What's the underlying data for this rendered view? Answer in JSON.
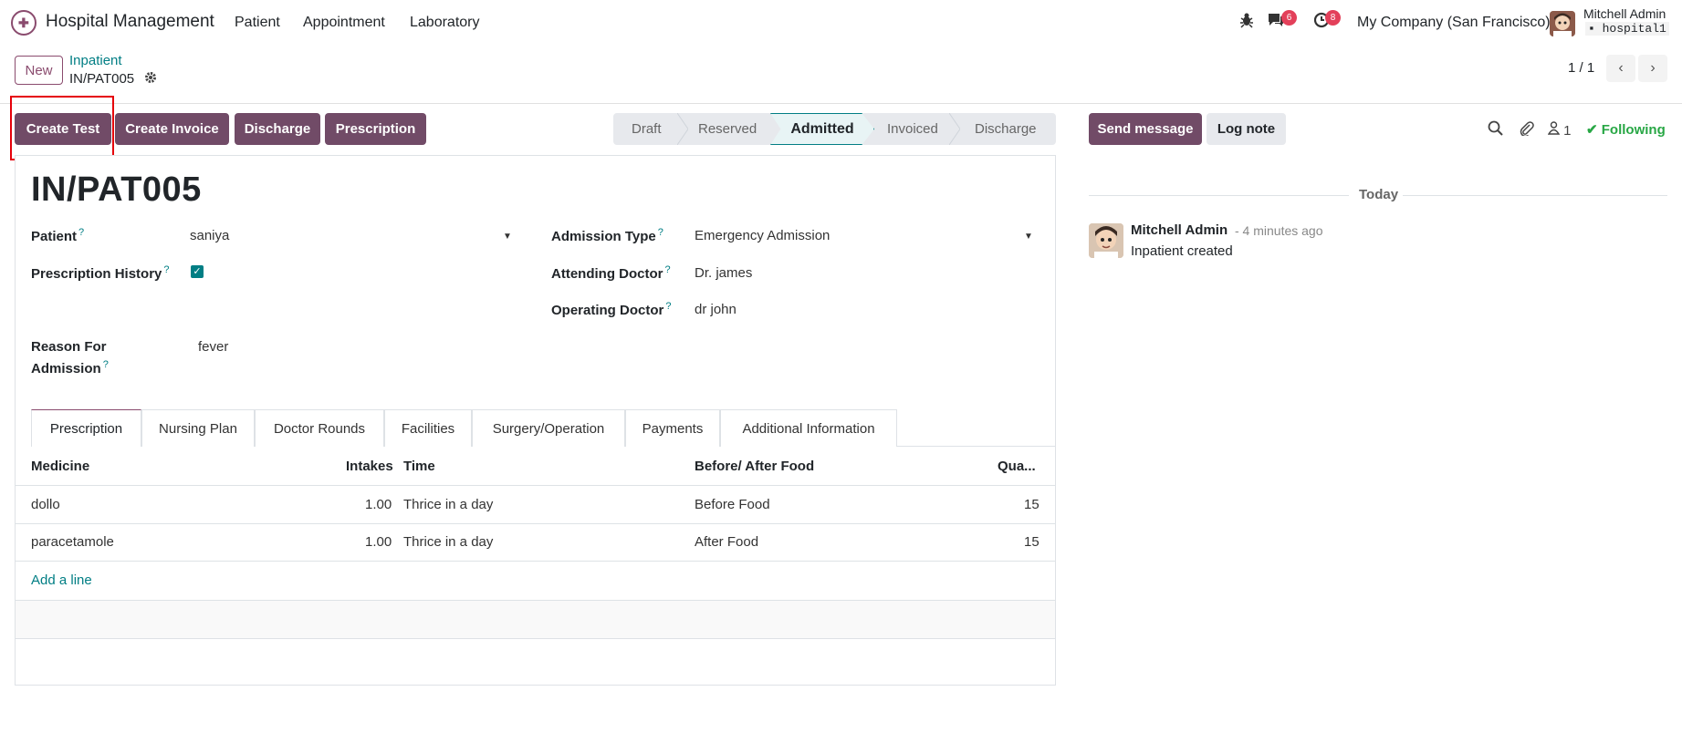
{
  "app": {
    "name": "Hospital Management"
  },
  "menu": [
    "Patient",
    "Appointment",
    "Laboratory"
  ],
  "systray": {
    "messages_badge": "6",
    "activities_badge": "8",
    "company": "My Company (San Francisco)",
    "user_name": "Mitchell Admin",
    "db_name": "hospital1"
  },
  "control": {
    "new_label": "New",
    "breadcrumb_parent": "Inpatient",
    "breadcrumb_current": "IN/PAT005",
    "pager": "1 / 1"
  },
  "actions": [
    "Create Test",
    "Create Invoice",
    "Discharge",
    "Prescription"
  ],
  "status": {
    "stages": [
      "Draft",
      "Reserved",
      "Admitted",
      "Invoiced",
      "Discharge"
    ],
    "active": "Admitted"
  },
  "record": {
    "title": "IN/PAT005",
    "patient_label": "Patient",
    "patient_value": "saniya",
    "prescription_history_label": "Prescription History",
    "prescription_history_checked": true,
    "reason_label_1": "Reason For",
    "reason_label_2": "Admission",
    "reason_value": "fever",
    "admission_type_label": "Admission Type",
    "admission_type_value": "Emergency Admission",
    "attending_doctor_label": "Attending Doctor",
    "attending_doctor_value": "Dr. james",
    "operating_doctor_label": "Operating Doctor",
    "operating_doctor_value": "dr john",
    "help_mark": "?"
  },
  "tabs": [
    "Prescription",
    "Nursing Plan",
    "Doctor Rounds",
    "Facilities",
    "Surgery/Operation",
    "Payments",
    "Additional Information"
  ],
  "prescription_table": {
    "headers": [
      "Medicine",
      "Intakes",
      "Time",
      "Before/ After Food",
      "Qua..."
    ],
    "rows": [
      [
        "dollo",
        "1.00",
        "Thrice in a day",
        "Before Food",
        "15"
      ],
      [
        "paracetamole",
        "1.00",
        "Thrice in a day",
        "After Food",
        "15"
      ]
    ],
    "add_line": "Add a line"
  },
  "chatter": {
    "send_message": "Send message",
    "log_note": "Log note",
    "followers_count": "1",
    "following": "Following",
    "date_separator": "Today",
    "message_author": "Mitchell Admin",
    "message_time": "- 4 minutes ago",
    "message_body": "Inpatient created"
  },
  "colors": {
    "primary": "#714b67",
    "accent": "#017e84",
    "badge": "#e3405a",
    "highlight": "#e5000a"
  },
  "icons": [
    "bug-icon",
    "chat-icon",
    "clock-icon",
    "gear-icon",
    "search-icon",
    "paperclip-icon",
    "user-icon",
    "check-icon"
  ]
}
